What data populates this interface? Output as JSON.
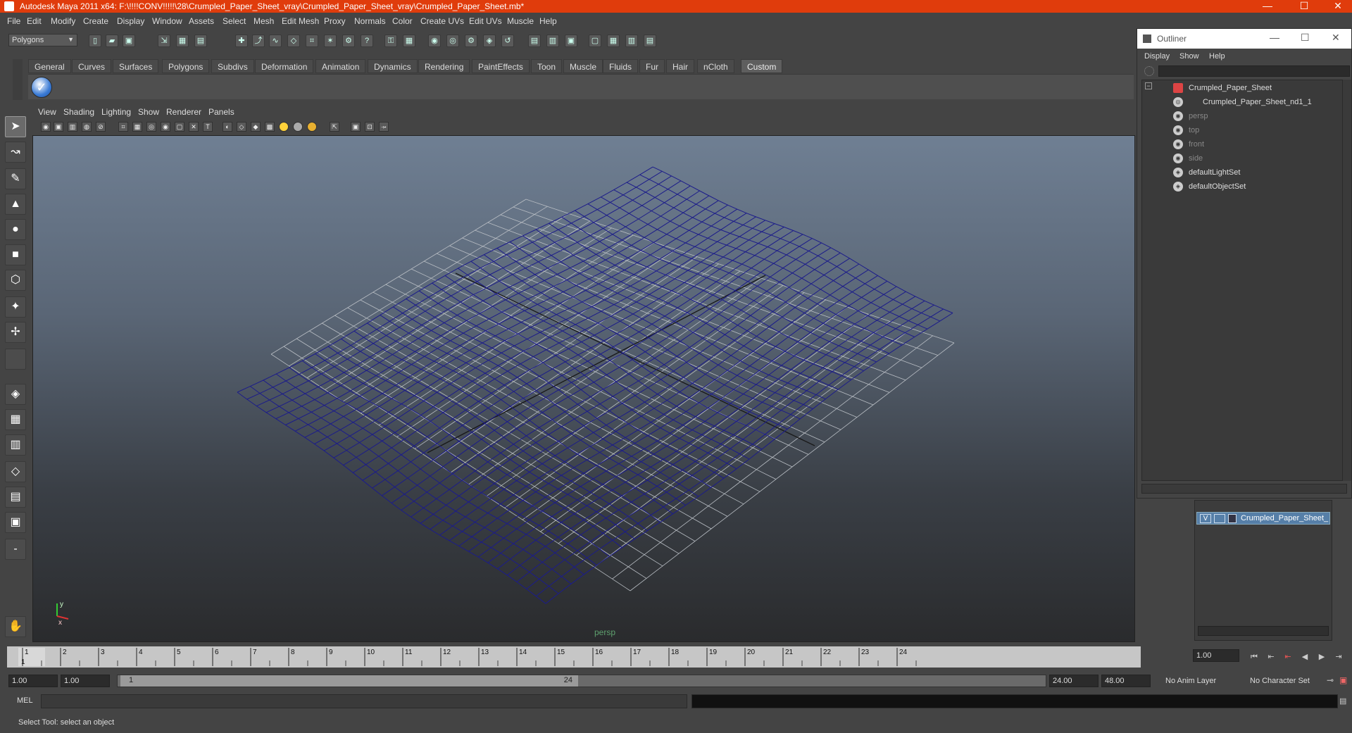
{
  "window": {
    "title": "Autodesk Maya 2011 x64: F:\\!!!!CONV!!!!!\\28\\Crumpled_Paper_Sheet_vray\\Crumpled_Paper_Sheet_vray\\Crumpled_Paper_Sheet.mb*",
    "minimize": "—",
    "maximize": "☐",
    "close": "✕"
  },
  "menubar": [
    "File",
    "Edit",
    "Modify",
    "Create",
    "Display",
    "Window",
    "Assets",
    "Select",
    "Mesh",
    "Edit Mesh",
    "Proxy",
    "Normals",
    "Color",
    "Create UVs",
    "Edit UVs",
    "Muscle",
    "Help"
  ],
  "toolbar": {
    "mode": "Polygons"
  },
  "shelf": {
    "tabs": [
      "General",
      "Curves",
      "Surfaces",
      "Polygons",
      "Subdivs",
      "Deformation",
      "Animation",
      "Dynamics",
      "Rendering",
      "PaintEffects",
      "Toon",
      "Muscle",
      "Fluids",
      "Fur",
      "Hair",
      "nCloth",
      "Custom"
    ],
    "active": "Custom",
    "button_icon": "checkmark-icon"
  },
  "viewport": {
    "menu": [
      "View",
      "Shading",
      "Lighting",
      "Show",
      "Renderer",
      "Panels"
    ],
    "camera_label": "persp",
    "mesh_color": "#1c1c8a",
    "axis": {
      "x": "x",
      "y": "y"
    }
  },
  "timeline": {
    "ticks": [
      "1",
      "2",
      "3",
      "4",
      "5",
      "6",
      "7",
      "8",
      "9",
      "10",
      "11",
      "12",
      "13",
      "14",
      "15",
      "16",
      "17",
      "18",
      "19",
      "20",
      "21",
      "22",
      "23",
      "24"
    ],
    "current_frame": "1",
    "current_field": "1.00"
  },
  "range": {
    "start": "1.00",
    "playback_start": "1.00",
    "slider_start": "1",
    "slider_end": "24",
    "playback_end": "24.00",
    "end": "48.00",
    "anim_layer": "No Anim Layer",
    "character_set": "No Character Set"
  },
  "command": {
    "label": "MEL"
  },
  "help": {
    "text": "Select Tool: select an object"
  },
  "outliner": {
    "title": "Outliner",
    "menu": [
      "Display",
      "Show",
      "Help"
    ],
    "items": [
      {
        "label": "Crumpled_Paper_Sheet",
        "dim": false
      },
      {
        "label": "Crumpled_Paper_Sheet_nd1_1",
        "dim": false
      },
      {
        "label": "persp",
        "dim": true
      },
      {
        "label": "top",
        "dim": true
      },
      {
        "label": "front",
        "dim": true
      },
      {
        "label": "side",
        "dim": true
      },
      {
        "label": "defaultLightSet",
        "dim": false
      },
      {
        "label": "defaultObjectSet",
        "dim": false
      }
    ]
  },
  "layers": {
    "visible_flag": "V",
    "layer_name": "Crumpled_Paper_Sheet_"
  }
}
